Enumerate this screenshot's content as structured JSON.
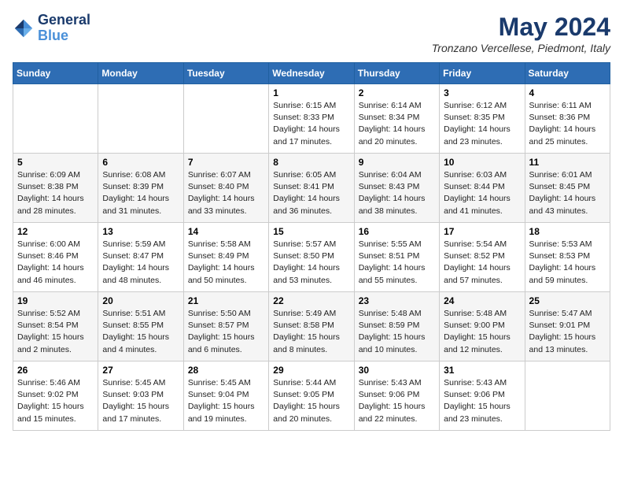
{
  "header": {
    "logo_line1": "General",
    "logo_line2": "Blue",
    "month": "May 2024",
    "location": "Tronzano Vercellese, Piedmont, Italy"
  },
  "days_of_week": [
    "Sunday",
    "Monday",
    "Tuesday",
    "Wednesday",
    "Thursday",
    "Friday",
    "Saturday"
  ],
  "weeks": [
    [
      {
        "day": "",
        "info": ""
      },
      {
        "day": "",
        "info": ""
      },
      {
        "day": "",
        "info": ""
      },
      {
        "day": "1",
        "info": "Sunrise: 6:15 AM\nSunset: 8:33 PM\nDaylight: 14 hours\nand 17 minutes."
      },
      {
        "day": "2",
        "info": "Sunrise: 6:14 AM\nSunset: 8:34 PM\nDaylight: 14 hours\nand 20 minutes."
      },
      {
        "day": "3",
        "info": "Sunrise: 6:12 AM\nSunset: 8:35 PM\nDaylight: 14 hours\nand 23 minutes."
      },
      {
        "day": "4",
        "info": "Sunrise: 6:11 AM\nSunset: 8:36 PM\nDaylight: 14 hours\nand 25 minutes."
      }
    ],
    [
      {
        "day": "5",
        "info": "Sunrise: 6:09 AM\nSunset: 8:38 PM\nDaylight: 14 hours\nand 28 minutes."
      },
      {
        "day": "6",
        "info": "Sunrise: 6:08 AM\nSunset: 8:39 PM\nDaylight: 14 hours\nand 31 minutes."
      },
      {
        "day": "7",
        "info": "Sunrise: 6:07 AM\nSunset: 8:40 PM\nDaylight: 14 hours\nand 33 minutes."
      },
      {
        "day": "8",
        "info": "Sunrise: 6:05 AM\nSunset: 8:41 PM\nDaylight: 14 hours\nand 36 minutes."
      },
      {
        "day": "9",
        "info": "Sunrise: 6:04 AM\nSunset: 8:43 PM\nDaylight: 14 hours\nand 38 minutes."
      },
      {
        "day": "10",
        "info": "Sunrise: 6:03 AM\nSunset: 8:44 PM\nDaylight: 14 hours\nand 41 minutes."
      },
      {
        "day": "11",
        "info": "Sunrise: 6:01 AM\nSunset: 8:45 PM\nDaylight: 14 hours\nand 43 minutes."
      }
    ],
    [
      {
        "day": "12",
        "info": "Sunrise: 6:00 AM\nSunset: 8:46 PM\nDaylight: 14 hours\nand 46 minutes."
      },
      {
        "day": "13",
        "info": "Sunrise: 5:59 AM\nSunset: 8:47 PM\nDaylight: 14 hours\nand 48 minutes."
      },
      {
        "day": "14",
        "info": "Sunrise: 5:58 AM\nSunset: 8:49 PM\nDaylight: 14 hours\nand 50 minutes."
      },
      {
        "day": "15",
        "info": "Sunrise: 5:57 AM\nSunset: 8:50 PM\nDaylight: 14 hours\nand 53 minutes."
      },
      {
        "day": "16",
        "info": "Sunrise: 5:55 AM\nSunset: 8:51 PM\nDaylight: 14 hours\nand 55 minutes."
      },
      {
        "day": "17",
        "info": "Sunrise: 5:54 AM\nSunset: 8:52 PM\nDaylight: 14 hours\nand 57 minutes."
      },
      {
        "day": "18",
        "info": "Sunrise: 5:53 AM\nSunset: 8:53 PM\nDaylight: 14 hours\nand 59 minutes."
      }
    ],
    [
      {
        "day": "19",
        "info": "Sunrise: 5:52 AM\nSunset: 8:54 PM\nDaylight: 15 hours\nand 2 minutes."
      },
      {
        "day": "20",
        "info": "Sunrise: 5:51 AM\nSunset: 8:55 PM\nDaylight: 15 hours\nand 4 minutes."
      },
      {
        "day": "21",
        "info": "Sunrise: 5:50 AM\nSunset: 8:57 PM\nDaylight: 15 hours\nand 6 minutes."
      },
      {
        "day": "22",
        "info": "Sunrise: 5:49 AM\nSunset: 8:58 PM\nDaylight: 15 hours\nand 8 minutes."
      },
      {
        "day": "23",
        "info": "Sunrise: 5:48 AM\nSunset: 8:59 PM\nDaylight: 15 hours\nand 10 minutes."
      },
      {
        "day": "24",
        "info": "Sunrise: 5:48 AM\nSunset: 9:00 PM\nDaylight: 15 hours\nand 12 minutes."
      },
      {
        "day": "25",
        "info": "Sunrise: 5:47 AM\nSunset: 9:01 PM\nDaylight: 15 hours\nand 13 minutes."
      }
    ],
    [
      {
        "day": "26",
        "info": "Sunrise: 5:46 AM\nSunset: 9:02 PM\nDaylight: 15 hours\nand 15 minutes."
      },
      {
        "day": "27",
        "info": "Sunrise: 5:45 AM\nSunset: 9:03 PM\nDaylight: 15 hours\nand 17 minutes."
      },
      {
        "day": "28",
        "info": "Sunrise: 5:45 AM\nSunset: 9:04 PM\nDaylight: 15 hours\nand 19 minutes."
      },
      {
        "day": "29",
        "info": "Sunrise: 5:44 AM\nSunset: 9:05 PM\nDaylight: 15 hours\nand 20 minutes."
      },
      {
        "day": "30",
        "info": "Sunrise: 5:43 AM\nSunset: 9:06 PM\nDaylight: 15 hours\nand 22 minutes."
      },
      {
        "day": "31",
        "info": "Sunrise: 5:43 AM\nSunset: 9:06 PM\nDaylight: 15 hours\nand 23 minutes."
      },
      {
        "day": "",
        "info": ""
      }
    ]
  ]
}
